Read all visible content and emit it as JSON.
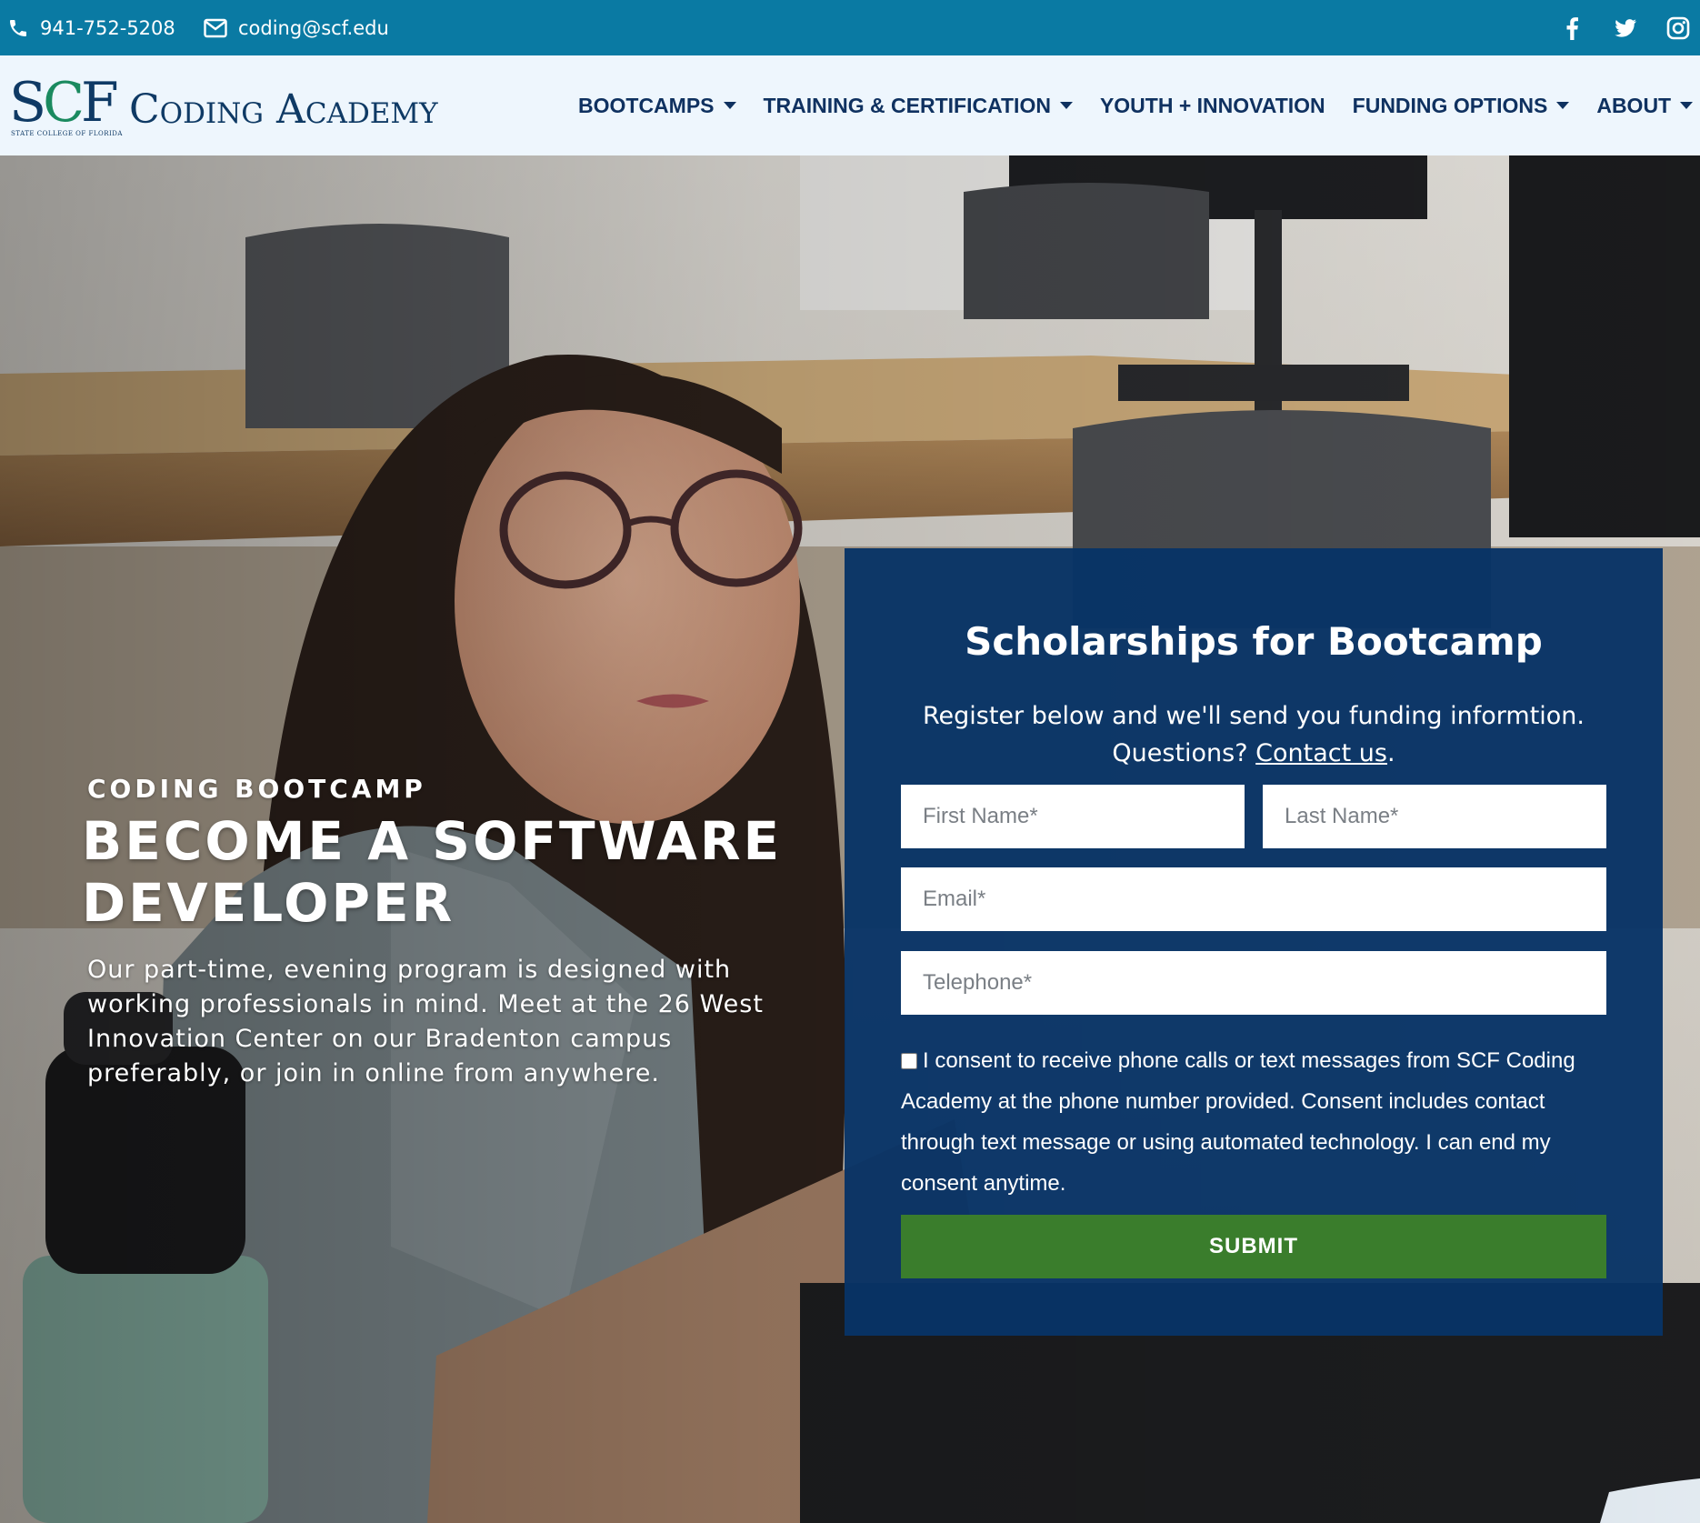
{
  "topbar": {
    "phone": "941-752-5208",
    "email": "coding@scf.edu",
    "phone_icon": "phone-icon",
    "email_icon": "envelope-icon",
    "socials": [
      "facebook-icon",
      "twitter-icon",
      "instagram-icon"
    ]
  },
  "header": {
    "logo_mark": "SCF",
    "logo_subtitle": "STATE COLLEGE OF FLORIDA",
    "logo_title": "Coding Academy",
    "nav": [
      {
        "label": "BOOTCAMPS",
        "has_dropdown": true
      },
      {
        "label": "TRAINING & CERTIFICATION",
        "has_dropdown": true
      },
      {
        "label": "YOUTH + INNOVATION",
        "has_dropdown": false
      },
      {
        "label": "FUNDING OPTIONS",
        "has_dropdown": true
      },
      {
        "label": "ABOUT",
        "has_dropdown": true
      }
    ]
  },
  "hero": {
    "eyebrow": "CODING BOOTCAMP",
    "headline": "BECOME A SOFTWARE DEVELOPER",
    "body": "Our part-time, evening program is designed with working professionals in mind. Meet at the 26 West Innovation Center on our Bradenton campus preferably, or join in online from anywhere."
  },
  "form": {
    "title": "Scholarships for Bootcamp",
    "subtitle_line1": "Register below and we'll send you funding informtion.",
    "subtitle_line2_prefix": "Questions?",
    "contact_link": "Contact us",
    "subtitle_line2_suffix": ".",
    "first_name_placeholder": "First Name*",
    "last_name_placeholder": "Last Name*",
    "email_placeholder": "Email*",
    "telephone_placeholder": "Telephone*",
    "consent_text": "I consent to receive phone calls or text messages from SCF Coding Academy at the phone number provided. Consent includes contact through text message or using automated technology. I can end my consent anytime.",
    "submit_label": "SUBMIT"
  },
  "colors": {
    "topbar": "#0a7aa3",
    "header_bg": "#eef6fd",
    "nav_text": "#0f3160",
    "form_panel": "#073366",
    "submit": "#3a7d2c"
  }
}
